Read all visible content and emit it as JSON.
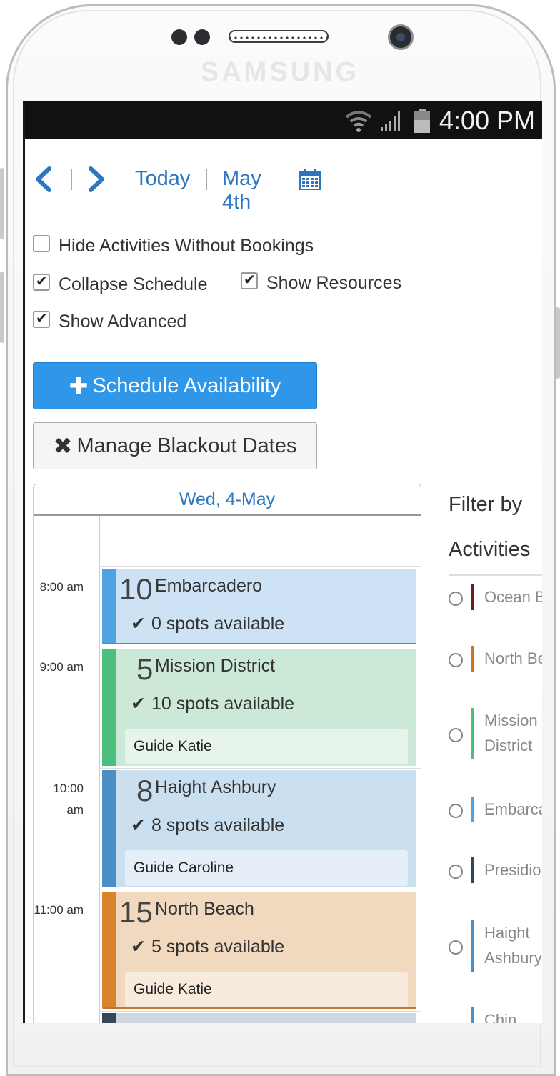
{
  "device": {
    "brand": "SAMSUNG"
  },
  "statusbar": {
    "time": "4:00 PM"
  },
  "nav": {
    "prev_icon": "chevron-left-icon",
    "next_icon": "chevron-right-icon",
    "today_label": "Today",
    "date_label": "May 4th",
    "calendar_icon": "calendar-icon"
  },
  "options": {
    "hide_activities": {
      "label": "Hide Activities Without Bookings",
      "checked": false
    },
    "collapse_schedule": {
      "label": "Collapse Schedule",
      "checked": true
    },
    "show_resources": {
      "label": "Show Resources",
      "checked": true
    },
    "show_advanced": {
      "label": "Show Advanced",
      "checked": true
    }
  },
  "buttons": {
    "schedule_label": "Schedule Availability",
    "blackout_label": "Manage Blackout Dates"
  },
  "schedule": {
    "header": "Wed, 4-May",
    "times": [
      "8:00 am",
      "9:00 am",
      "10:00 am",
      "11:00 am"
    ],
    "events": [
      {
        "number": "10",
        "title": "Embarcadero",
        "spots": "0 spots available",
        "guide": "",
        "color": "#4ea3e0",
        "bg": "#cde3f5"
      },
      {
        "number": "5",
        "title": "Mission District",
        "spots": "10 spots available",
        "guide": "Guide Katie",
        "color": "#4cbf7c",
        "bg": "#cbe9d6"
      },
      {
        "number": "8",
        "title": "Haight Ashbury",
        "spots": "8 spots available",
        "guide": "Guide Caroline",
        "color": "#4a8fc6",
        "bg": "#cadff0"
      },
      {
        "number": "15",
        "title": "North Beach",
        "spots": "5 spots available",
        "guide": "Guide Katie",
        "color": "#d7842a",
        "bg": "#f0d9bf"
      }
    ]
  },
  "filter": {
    "title_line1": "Filter by",
    "title_line2": "Activities",
    "items": [
      {
        "name": "Ocean B",
        "color": "#6b1e1e"
      },
      {
        "name": "North Be",
        "color": "#c8742a"
      },
      {
        "name": "Mission District",
        "line1": "Mission",
        "line2": "District",
        "color": "#4cbf7c"
      },
      {
        "name": "Embarca",
        "color": "#4ea3e0"
      },
      {
        "name": "Presidio",
        "color": "#35455a"
      },
      {
        "name": "Haight Ashbury",
        "line1": "Haight",
        "line2": "Ashbury",
        "color": "#4a8fc6"
      },
      {
        "name": "Chin",
        "color": "#4a8fc6"
      }
    ]
  }
}
